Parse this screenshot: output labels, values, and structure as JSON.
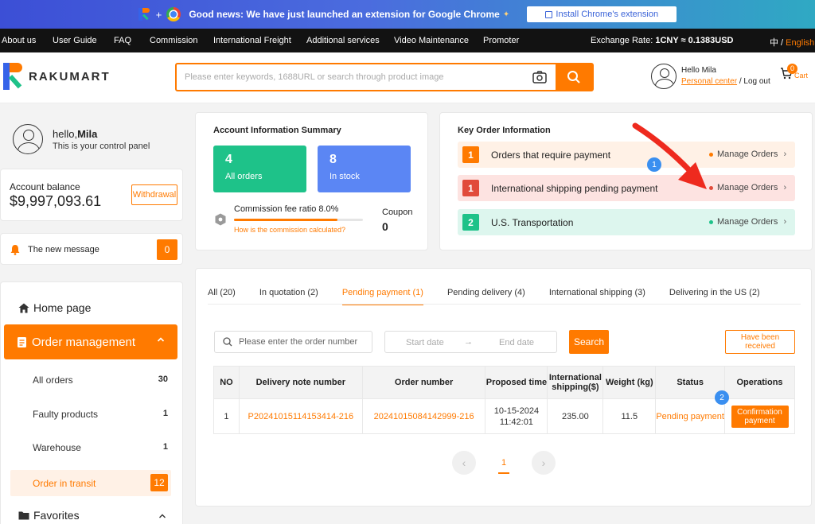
{
  "banner": {
    "plus": "+",
    "news": "Good news: We have just launched an extension for Google Chrome",
    "ext_button": "Install Chrome's extension"
  },
  "topnav": {
    "items": [
      "About us",
      "User Guide",
      "FAQ",
      "Commission",
      "International Freight",
      "Additional services",
      "Video Maintenance",
      "Promoter"
    ],
    "rate_label": "Exchange Rate: ",
    "rate_value": "1CNY ≈ 0.1383USD",
    "lang_cn": "中",
    "lang_sep": " / ",
    "lang_en": "English"
  },
  "header": {
    "logo_text": "RAKUMART",
    "search_placeholder": "Please enter keywords, 1688URL or search through product image",
    "greeting": "Hello Mila",
    "personal_center": "Personal center",
    "logout": " / Log out",
    "cart_count": "0",
    "cart_label": "Cart"
  },
  "sidebar": {
    "hello": "hello,",
    "user": "Mila",
    "subtitle": "This is your control panel",
    "balance_label": "Account balance",
    "balance_amount": "$9,997,093.61",
    "withdraw": "Withdrawal",
    "message_label": "The new message",
    "message_count": "0",
    "home": "Home page",
    "order_management": "Order management",
    "sub_items": [
      {
        "label": "All orders",
        "count": "30"
      },
      {
        "label": "Faulty products",
        "count": "1"
      },
      {
        "label": "Warehouse",
        "count": "1"
      }
    ],
    "active_sub": {
      "label": "Order in transit",
      "count": "12"
    },
    "favorites": "Favorites"
  },
  "summary": {
    "title": "Account Information Summary",
    "all_orders_count": "4",
    "all_orders_label": "All orders",
    "in_stock_count": "8",
    "in_stock_label": "In stock",
    "commission_label": "Commission fee ratio 8.0%",
    "commission_progress": 0.8,
    "how_calc": "How is the commission calculated?",
    "coupon_label": "Coupon",
    "coupon_count": "0"
  },
  "keyinfo": {
    "title": "Key Order Information",
    "rows": [
      {
        "num": "1",
        "label": "Orders that require payment",
        "action": "Manage Orders"
      },
      {
        "num": "1",
        "label": "International shipping pending payment",
        "action": "Manage Orders"
      },
      {
        "num": "2",
        "label": "U.S. Transportation",
        "action": "Manage Orders"
      }
    ],
    "step_badge": "1"
  },
  "orders": {
    "tabs": [
      "All (20)",
      "In quotation (2)",
      "Pending payment (1)",
      "Pending delivery (4)",
      "International shipping (3)",
      "Delivering in the US (2)"
    ],
    "active_tab": 2,
    "search_placeholder": "Please enter the order number",
    "start_date": "Start date",
    "arrow": "→",
    "end_date": "End date",
    "search_button": "Search",
    "received_button": "Have been received",
    "columns": [
      "NO",
      "Delivery note number",
      "Order number",
      "Proposed time",
      "International shipping($)",
      "Weight (kg)",
      "Status",
      "Operations"
    ],
    "rows": [
      {
        "no": "1",
        "delivery_note": "P20241015114153414-216",
        "order_number": "20241015084142999-216",
        "proposed_time": "10-15-2024 11:42:01",
        "shipping": "235.00",
        "weight": "11.5",
        "status": "Pending payment",
        "operation": "Confirmation payment"
      }
    ],
    "step_badge": "2",
    "page": "1",
    "prev": "‹",
    "next": "›"
  },
  "colors": {
    "accent": "#ff7a00",
    "green": "#1ec289",
    "blue": "#5b86f4",
    "red": "#e14b3b",
    "annotation_arrow": "#ee2a1e"
  }
}
